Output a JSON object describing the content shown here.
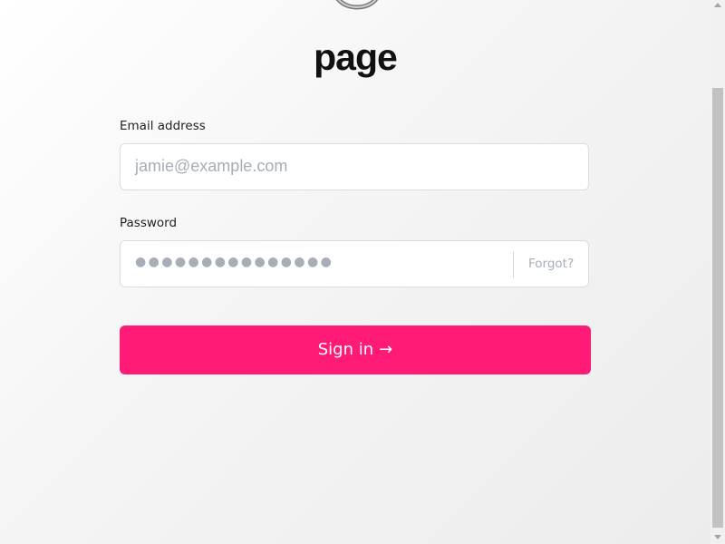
{
  "brand": {
    "logo_icon": "ring-logo-icon",
    "name": "page"
  },
  "form": {
    "email": {
      "label": "Email address",
      "placeholder": "jamie@example.com"
    },
    "password": {
      "label": "Password",
      "masked_value": "●●●●●●●●●●●●●●●",
      "forgot_label": "Forgot?"
    },
    "submit": {
      "label": "Sign in",
      "icon": "arrow-right-icon",
      "arrow": "→"
    }
  },
  "colors": {
    "accent": "#ff1a75",
    "placeholder": "#a7aeb8",
    "text": "#111111"
  }
}
